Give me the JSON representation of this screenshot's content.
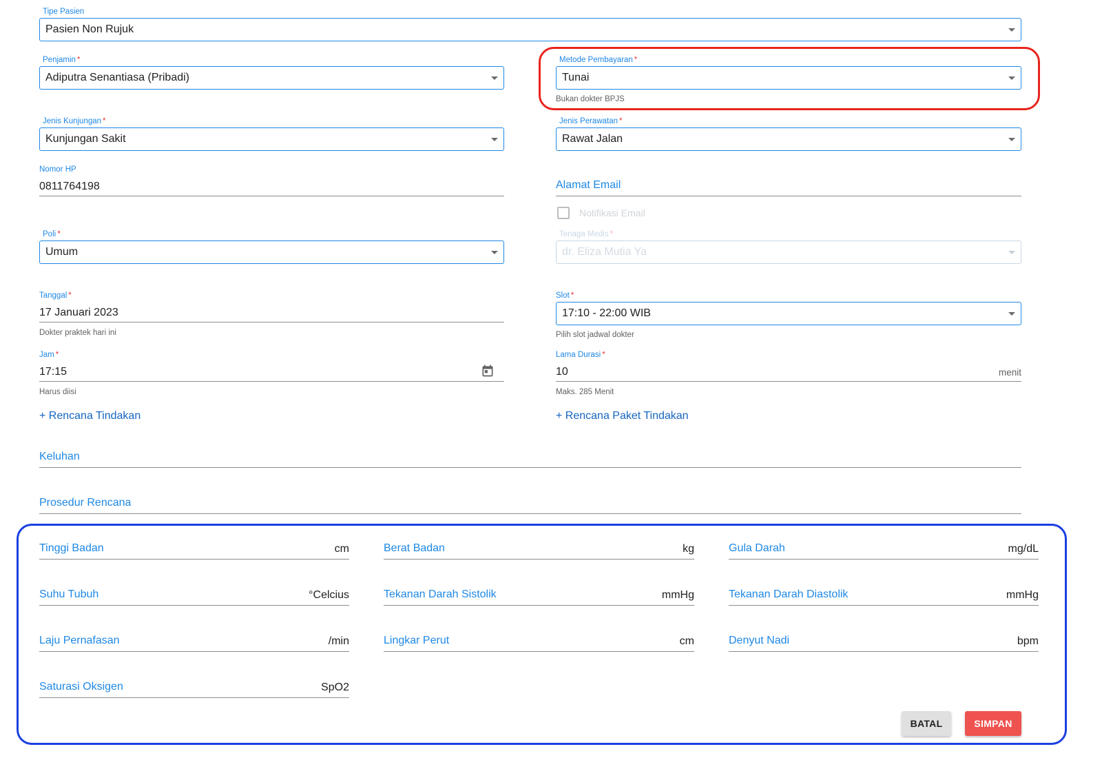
{
  "tipe_pasien": {
    "label": "Tipe Pasien",
    "value": "Pasien Non Rujuk"
  },
  "penjamin": {
    "label": "Penjamin",
    "required_mark": "*",
    "value": "Adiputra Senantiasa (Pribadi)"
  },
  "metode_pembayaran": {
    "label": "Metode Pembayaran",
    "required_mark": "*",
    "value": "Tunai",
    "helper": "Bukan dokter BPJS"
  },
  "jenis_kunjungan": {
    "label": "Jenis Kunjungan",
    "required_mark": "*",
    "value": "Kunjungan Sakit"
  },
  "jenis_perawatan": {
    "label": "Jenis Perawatan",
    "required_mark": "*",
    "value": "Rawat Jalan"
  },
  "nomor_hp": {
    "label": "Nomor HP",
    "value": "0811764198"
  },
  "alamat_email": {
    "placeholder": "Alamat Email"
  },
  "notifikasi_email": {
    "label": "Notifikasi Email",
    "checked": false
  },
  "poli": {
    "label": "Poli",
    "required_mark": "*",
    "value": "Umum"
  },
  "tenaga_medis": {
    "label": "Tenaga Medis",
    "required_mark": "*",
    "value": "dr. Eliza Mutia Ya"
  },
  "tanggal": {
    "label": "Tanggal",
    "required_mark": "*",
    "value": "17 Januari 2023",
    "helper": "Dokter praktek hari ini"
  },
  "slot": {
    "label": "Slot",
    "required_mark": "*",
    "value": "17:10 - 22:00 WIB",
    "helper": "Pilih slot jadwal dokter"
  },
  "jam": {
    "label": "Jam",
    "required_mark": "*",
    "value": "17:15",
    "helper": "Harus diisi",
    "icon": "calendar-icon"
  },
  "lama_durasi": {
    "label": "Lama Durasi",
    "required_mark": "*",
    "value": "10",
    "unit": "menit",
    "helper": "Maks. 285 Menit"
  },
  "links": {
    "rencana_tindakan": "+ Rencana Tindakan",
    "rencana_paket_tindakan": "+ Rencana Paket Tindakan"
  },
  "keluhan": {
    "placeholder": "Keluhan"
  },
  "prosedur_rencana": {
    "placeholder": "Prosedur Rencana"
  },
  "vitals": {
    "tinggi_badan": {
      "placeholder": "Tinggi Badan",
      "unit": "cm"
    },
    "berat_badan": {
      "placeholder": "Berat Badan",
      "unit": "kg"
    },
    "gula_darah": {
      "placeholder": "Gula Darah",
      "unit": "mg/dL"
    },
    "suhu_tubuh": {
      "placeholder": "Suhu Tubuh",
      "unit": "°Celcius"
    },
    "tekanan_sistolik": {
      "placeholder": "Tekanan Darah Sistolik",
      "unit": "mmHg"
    },
    "tekanan_diastolik": {
      "placeholder": "Tekanan Darah Diastolik",
      "unit": "mmHg"
    },
    "laju_pernafasan": {
      "placeholder": "Laju Pernafasan",
      "unit": "/min"
    },
    "lingkar_perut": {
      "placeholder": "Lingkar Perut",
      "unit": "cm"
    },
    "denyut_nadi": {
      "placeholder": "Denyut Nadi",
      "unit": "bpm"
    },
    "saturasi_oksigen": {
      "placeholder": "Saturasi Oksigen",
      "unit": "SpO2"
    }
  },
  "buttons": {
    "cancel": "BATAL",
    "save": "SIMPAN"
  },
  "colors": {
    "accent": "#1e88e5",
    "required": "#e53935",
    "save_button": "#ef5350",
    "highlight_red": "#e8241d",
    "highlight_blue": "#1a3fe0"
  }
}
